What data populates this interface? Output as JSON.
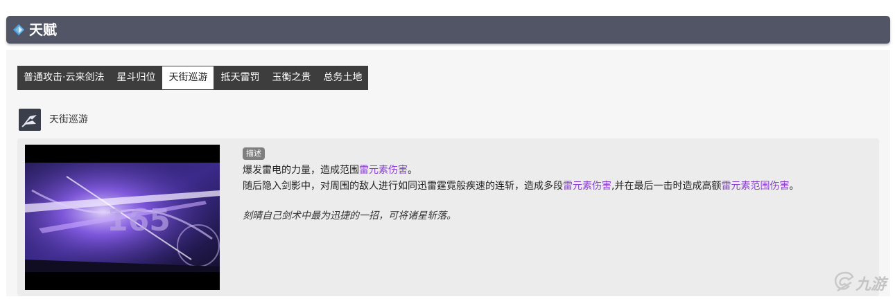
{
  "header": {
    "title": "天赋"
  },
  "tabs": [
    {
      "label": "普通攻击·云来剑法",
      "active": false
    },
    {
      "label": "星斗归位",
      "active": false
    },
    {
      "label": "天街巡游",
      "active": true
    },
    {
      "label": "抵天雷罚",
      "active": false
    },
    {
      "label": "玉衡之贵",
      "active": false
    },
    {
      "label": "总务土地",
      "active": false
    }
  ],
  "skill": {
    "name": "天街巡游",
    "video_overlay_number": "165",
    "badge": "描述",
    "line1": {
      "a": "爆发雷电的力量，造成范围",
      "kw1": "雷元素伤害",
      "b": "。"
    },
    "line2": {
      "a": "随后隐入剑影中，对周围的敌人进行如同迅雷霆霓般疾速的连斩，造成多段",
      "kw1": "雷元素伤害",
      "b": ",并在最后一击时造成高额",
      "kw2": "雷元素范围伤害",
      "c": "。"
    },
    "flavor": "刻晴自己剑术中最为迅捷的一招，可将诸星斩落。"
  },
  "watermark": {
    "text": "九游"
  },
  "colors": {
    "header_bg": "#525566",
    "tab_bg": "#3d3d3d",
    "keyword": "#8a3fd1",
    "icon_accent": "#5fb4e8"
  }
}
